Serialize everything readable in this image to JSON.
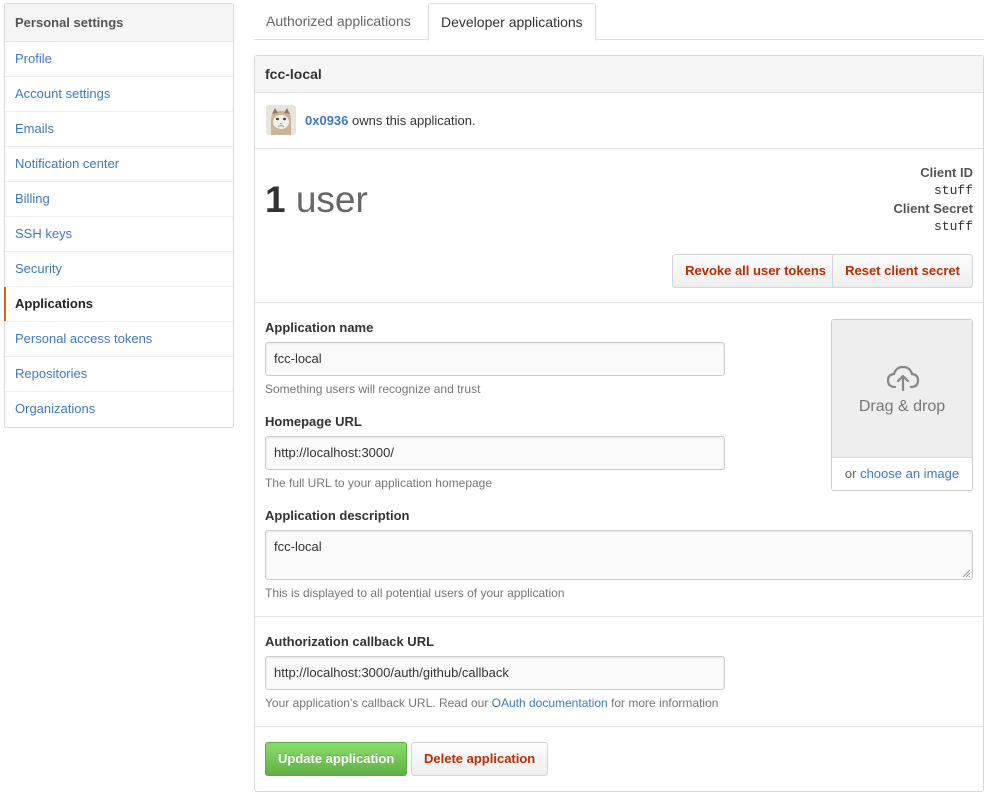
{
  "sidebar": {
    "heading": "Personal settings",
    "items": [
      {
        "label": "Profile"
      },
      {
        "label": "Account settings"
      },
      {
        "label": "Emails"
      },
      {
        "label": "Notification center"
      },
      {
        "label": "Billing"
      },
      {
        "label": "SSH keys"
      },
      {
        "label": "Security"
      },
      {
        "label": "Applications",
        "selected": true
      },
      {
        "label": "Personal access tokens"
      },
      {
        "label": "Repositories"
      },
      {
        "label": "Organizations"
      }
    ]
  },
  "tabs": [
    {
      "label": "Authorized applications"
    },
    {
      "label": "Developer applications",
      "selected": true
    }
  ],
  "app": {
    "name": "fcc-local",
    "owner": "0x0936",
    "owner_suffix": " owns this application.",
    "user_count": "1",
    "user_word": " user",
    "client_id_label": "Client ID",
    "client_id": "stuff",
    "client_secret_label": "Client Secret",
    "client_secret": "stuff",
    "revoke_label": "Revoke all user tokens",
    "reset_label": "Reset client secret"
  },
  "form": {
    "name_label": "Application name",
    "name_value": "fcc-local",
    "name_hint": "Something users will recognize and trust",
    "homepage_label": "Homepage URL",
    "homepage_value": "http://localhost:3000/",
    "homepage_hint": "The full URL to your application homepage",
    "description_label": "Application description",
    "description_value": "fcc-local",
    "description_hint": "This is displayed to all potential users of your application",
    "callback_label": "Authorization callback URL",
    "callback_value": "http://localhost:3000/auth/github/callback",
    "callback_hint_prefix": "Your application's callback URL. Read our ",
    "callback_hint_link": "OAuth documentation",
    "callback_hint_suffix": " for more information"
  },
  "dropzone": {
    "text": "Drag & drop",
    "or_text": "or ",
    "choose_link": "choose an image"
  },
  "actions": {
    "update_label": "Update application",
    "delete_label": "Delete application"
  },
  "colors": {
    "link": "#4078c0",
    "danger": "#bd2c00",
    "primary_green": "#60b044",
    "selected_accent": "#d26911"
  }
}
